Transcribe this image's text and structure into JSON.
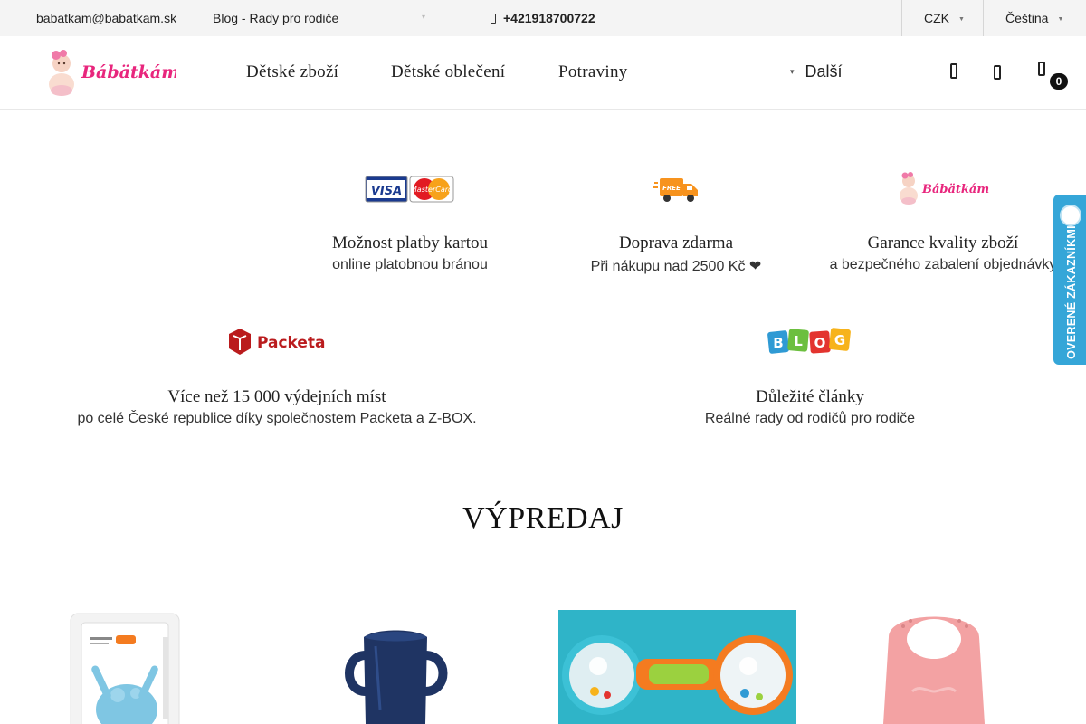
{
  "topbar": {
    "email": "babatkam@babatkam.sk",
    "blog": "Blog - Rady pro rodiče",
    "phone": "+421918700722",
    "currency": "CZK",
    "language": "Čeština"
  },
  "header": {
    "logo_text": "Bábätkám",
    "nav": [
      "Dětské zboží",
      "Dětské oblečení",
      "Potraviny"
    ],
    "more": "Další",
    "cart_count": "0"
  },
  "features": [
    {
      "title": "Možnost platby kartou",
      "subtitle": "online platobnou bránou",
      "icon": "card-payment-icon"
    },
    {
      "title": "Doprava zdarma",
      "subtitle": "Při nákupu nad 2500 Kč ❤",
      "icon": "free-delivery-truck-icon"
    },
    {
      "title": "Garance kvality zboží",
      "subtitle": "a bezpečného zabalení objednávky",
      "icon": "babatkam-logo-icon"
    },
    {
      "title": "Více než 15 000 výdejních míst",
      "subtitle": "po celé České republice díky společnostem Packeta a Z-BOX.",
      "icon": "packeta-logo-icon"
    },
    {
      "title": "Důležité články",
      "subtitle": "Reálné rady od rodičů pro rodiče",
      "icon": "blog-logo-icon"
    }
  ],
  "icon_texts": {
    "visa": "VISA",
    "mastercard": "MasterCard",
    "free": "FREE",
    "packeta": "Packeta",
    "blog_letters": [
      "B",
      "L",
      "O",
      "G"
    ]
  },
  "section_title": "VÝPREDAJ",
  "products": [
    {
      "icon": "silicone-teether-octopus-image"
    },
    {
      "icon": "blue-training-cup-image"
    },
    {
      "icon": "rattle-toy-image"
    },
    {
      "icon": "pink-silicone-bib-image"
    }
  ],
  "verified_badge": "OVERENÉ ZÁKAZNÍKMI",
  "colors": {
    "topbar_bg": "#f4f4f4",
    "brand_pink": "#e8267d",
    "verified_blue": "#35a6d8",
    "badge_black": "#111111"
  }
}
